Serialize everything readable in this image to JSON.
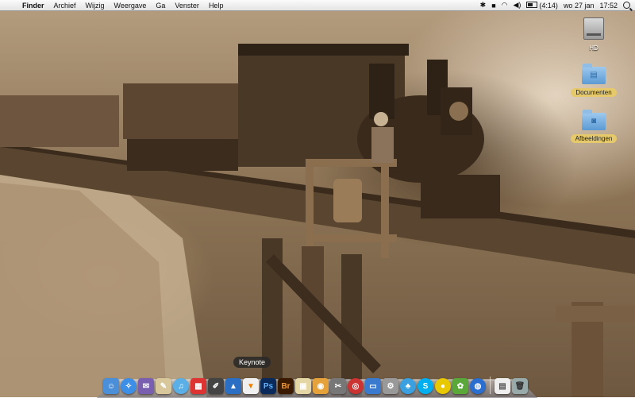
{
  "menubar": {
    "app_name": "Finder",
    "items": [
      "Archief",
      "Wijzig",
      "Weergave",
      "Ga",
      "Venster",
      "Help"
    ],
    "battery": "(4:14)",
    "date": "wo 27 jan",
    "time": "17:52"
  },
  "desktop_icons": [
    {
      "label": "HD",
      "icon": "hard-drive-icon"
    },
    {
      "label": "Documenten",
      "icon": "folder-icon"
    },
    {
      "label": "Afbeeldingen",
      "icon": "folder-icon"
    }
  ],
  "dock": {
    "tooltip": "Keynote",
    "ps_label": "Ps",
    "br_label": "Br"
  }
}
